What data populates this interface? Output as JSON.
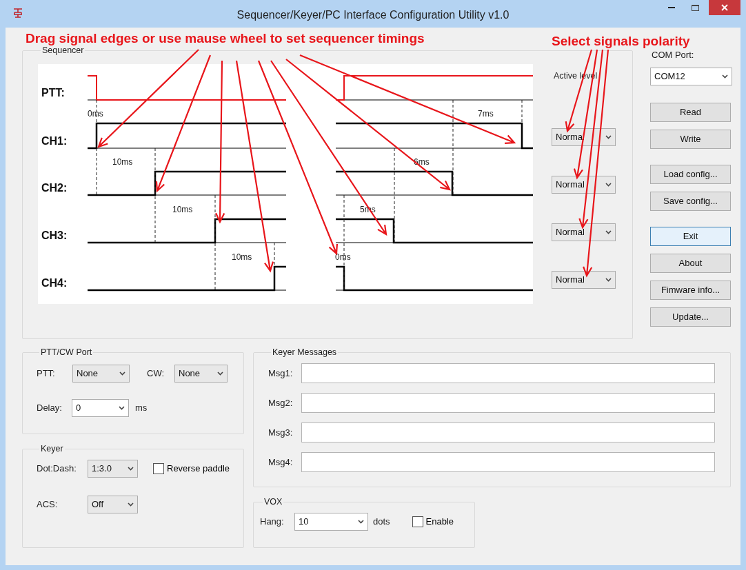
{
  "window": {
    "title": "Sequencer/Keyer/PC Interface Configuration Utility v1.0"
  },
  "annotations": [
    {
      "text": "Drag signal edges or use mause wheel to set sequencer timings"
    },
    {
      "text": "Select signals polarity"
    }
  ],
  "sequencer": {
    "title": "Sequencer",
    "active_level_label": "Active level",
    "channels": [
      {
        "name": "PTT:"
      },
      {
        "name": "CH1:",
        "on_delay": "0ms",
        "off_delay": "7ms",
        "polarity": "Normal"
      },
      {
        "name": "CH2:",
        "on_delay": "10ms",
        "off_delay": "6ms",
        "polarity": "Normal"
      },
      {
        "name": "CH3:",
        "on_delay": "10ms",
        "off_delay": "5ms",
        "polarity": "Normal"
      },
      {
        "name": "CH4:",
        "on_delay": "10ms",
        "off_delay": "0ms",
        "polarity": "Normal"
      }
    ]
  },
  "com_port": {
    "label": "COM Port:",
    "value": "COM12"
  },
  "button_groups": [
    [
      {
        "label": "Read",
        "focused": false
      },
      {
        "label": "Write",
        "focused": false
      }
    ],
    [
      {
        "label": "Load config...",
        "focused": false
      },
      {
        "label": "Save config...",
        "focused": false
      }
    ],
    [
      {
        "label": "Exit",
        "focused": true
      },
      {
        "label": "About",
        "focused": false
      },
      {
        "label": "Fimware info...",
        "focused": false
      },
      {
        "label": "Update...",
        "focused": false
      }
    ]
  ],
  "ptt_cw_port": {
    "title": "PTT/CW Port",
    "ptt": {
      "label": "PTT:",
      "value": "None"
    },
    "cw": {
      "label": "CW:",
      "value": "None"
    },
    "delay": {
      "label": "Delay:",
      "value": "0",
      "unit": "ms"
    }
  },
  "keyer": {
    "title": "Keyer",
    "dot_dash": {
      "label": "Dot:Dash:",
      "value": "1:3.0"
    },
    "reverse_paddle": {
      "label": "Reverse paddle",
      "checked": false
    },
    "acs": {
      "label": "ACS:",
      "value": "Off"
    }
  },
  "keyer_messages": {
    "title": "Keyer Messages",
    "messages": [
      {
        "label": "Msg1:"
      },
      {
        "label": "Msg2:"
      },
      {
        "label": "Msg3:"
      },
      {
        "label": "Msg4:"
      }
    ]
  },
  "vox": {
    "title": "VOX",
    "hang": {
      "label": "Hang:",
      "value": "10",
      "unit": "dots"
    },
    "enable": {
      "label": "Enable",
      "checked": false
    }
  }
}
